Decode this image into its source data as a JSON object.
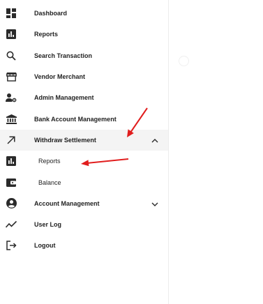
{
  "sidebar": {
    "items": [
      {
        "label": "Dashboard",
        "icon": "dashboard-icon"
      },
      {
        "label": "Reports",
        "icon": "bar-chart-icon"
      },
      {
        "label": "Search Transaction",
        "icon": "search-icon"
      },
      {
        "label": "Vendor Merchant",
        "icon": "storefront-icon"
      },
      {
        "label": "Admin Management",
        "icon": "user-settings-icon"
      },
      {
        "label": "Bank Account Management",
        "icon": "bank-icon"
      },
      {
        "label": "Withdraw Settlement",
        "icon": "arrow-up-right-icon",
        "expanded": true
      },
      {
        "label": "Reports",
        "icon": "bar-chart-icon",
        "sub": true
      },
      {
        "label": "Balance",
        "icon": "wallet-icon",
        "sub": true
      },
      {
        "label": "Account Management",
        "icon": "account-circle-icon",
        "collapsed": true
      },
      {
        "label": "User Log",
        "icon": "trending-icon"
      },
      {
        "label": "Logout",
        "icon": "logout-icon"
      }
    ]
  },
  "colors": {
    "icon": "#2b2b2b",
    "text": "#1f1f1f",
    "expanded_bg": "#f4f4f4",
    "annotation_arrow": "#e11d1d"
  }
}
